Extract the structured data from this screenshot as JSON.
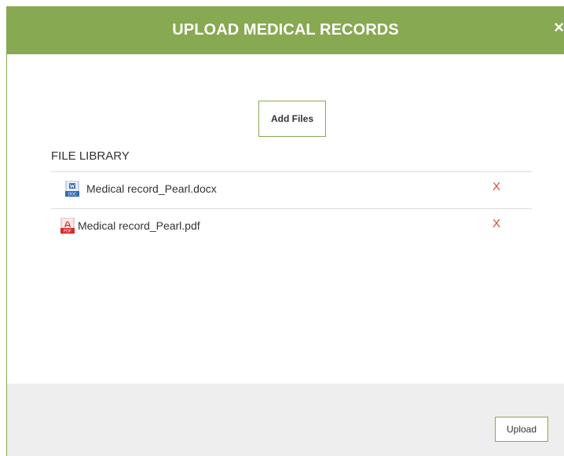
{
  "dialog": {
    "title": "UPLOAD MEDICAL RECORDS",
    "close_glyph": "×"
  },
  "add_files_label": "Add Files",
  "library": {
    "title": "FILE LIBRARY",
    "files": [
      {
        "name": "Medical record_Pearl.docx",
        "icon": "docx-file-icon",
        "icon_label": "DOC",
        "remove": "X"
      },
      {
        "name": "Medical record_Pearl.pdf",
        "icon": "pdf-file-icon",
        "icon_label": "PDF",
        "remove": "X"
      }
    ]
  },
  "footer": {
    "upload_label": "Upload"
  },
  "colors": {
    "accent": "#87a951",
    "remove": "#e0463c",
    "footer_bg": "#eeeeee"
  }
}
